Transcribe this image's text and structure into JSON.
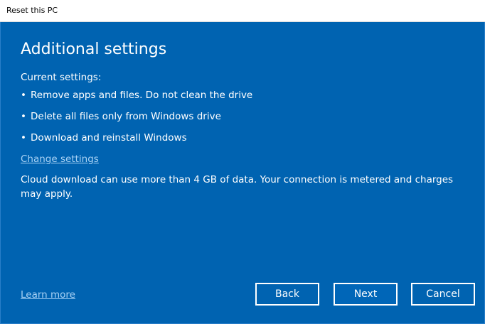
{
  "window": {
    "title": "Reset this PC"
  },
  "page": {
    "heading": "Additional settings",
    "current_label": "Current settings:",
    "settings": [
      "Remove apps and files. Do not clean the drive",
      "Delete all files only from Windows drive",
      "Download and reinstall Windows"
    ],
    "change_link": "Change settings",
    "note": "Cloud download can use more than 4 GB of data. Your connection is metered and charges may apply.",
    "learn_more": "Learn more"
  },
  "buttons": {
    "back": "Back",
    "next": "Next",
    "cancel": "Cancel"
  },
  "colors": {
    "background": "#0063b1",
    "link": "#a8d2f5",
    "text": "#ffffff"
  }
}
